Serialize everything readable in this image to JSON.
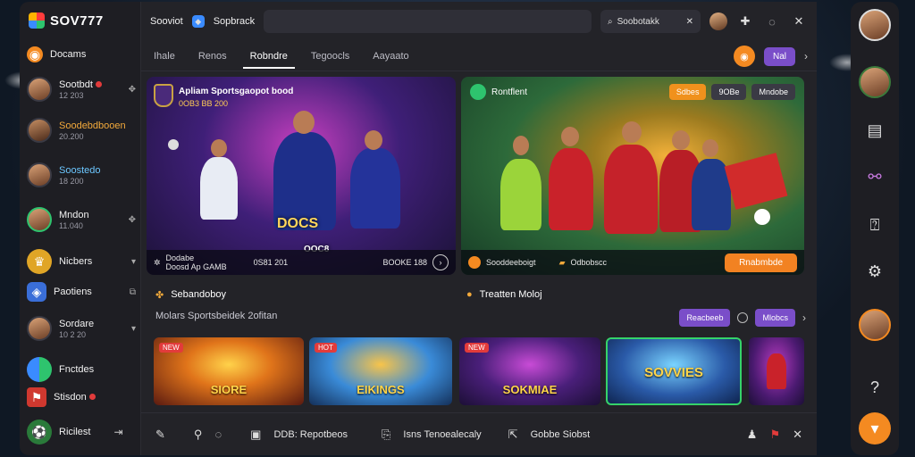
{
  "app": {
    "brand": "SOV777"
  },
  "sidebar": {
    "items": [
      {
        "name": "Docams",
        "sub": "",
        "trail": ""
      },
      {
        "name": "Sootbdt",
        "sub": "12 203",
        "trail": "✥"
      },
      {
        "name": "Soodebdbooen",
        "sub": "20.200",
        "trail": ""
      },
      {
        "name": "Soostedo",
        "sub": "18 200",
        "trail": ""
      },
      {
        "name": "Mndon",
        "sub": "11.040",
        "trail": "✥"
      },
      {
        "name": "Nicbers",
        "sub": "",
        "trail": "▾"
      },
      {
        "name": "Paotiens",
        "sub": "",
        "trail": "⧉"
      },
      {
        "name": "Sordare",
        "sub": "10 2 20",
        "trail": "▾"
      },
      {
        "name": "Fnctdes",
        "sub": "",
        "trail": ""
      },
      {
        "name": "Stisdon",
        "sub": "",
        "trail": ""
      }
    ],
    "bottom": {
      "name": "Ricilest"
    }
  },
  "topbar": {
    "label1": "Sooviot",
    "label2": "Sopbrack",
    "search_label": "Soobotakk"
  },
  "tabs": [
    "Ihale",
    "Renos",
    "Robndre",
    "Tegoocls",
    "Aayaato"
  ],
  "tabs_right": {
    "pill": "Nal"
  },
  "hero_left": {
    "title": "Apliam Sportsgaopot bood",
    "subtitle": "0OB3 BB 200",
    "big_text": "DOCS",
    "score_label": "OOC8",
    "score_value": "0S81 201",
    "footer_left": "Dodabe",
    "footer_left_sub": "Doosd Ap GAMB",
    "footer_right": "BOOKE 188"
  },
  "hero_right": {
    "title": "Rontflent",
    "chips": [
      "Sdbes",
      "9OBe",
      "Mndobe"
    ],
    "footer_left": "Sooddeeboigt",
    "footer_mid": "Odbobscc",
    "cta": "Rnabmbde"
  },
  "sections": {
    "left_title": "Sebandoboy",
    "right_title": "Treatten Moloj",
    "subtitle": "Molars Sportsbeidek 2ofitan",
    "filters": [
      "Reacbeeb",
      "Mlobcs"
    ]
  },
  "games": [
    {
      "title": "SIORE",
      "badge": "NEW"
    },
    {
      "title": "EIKINGS",
      "badge": "HOT"
    },
    {
      "title": "SOKMIAE",
      "badge": "NEW"
    },
    {
      "title": "SOVVIES",
      "badge": ""
    },
    {
      "title": "",
      "badge": ""
    }
  ],
  "bottombar": {
    "item1": "DDB: Repotbeos",
    "item2": "Isns Tenoealecaly",
    "item3": "Gobbe Siobst"
  }
}
